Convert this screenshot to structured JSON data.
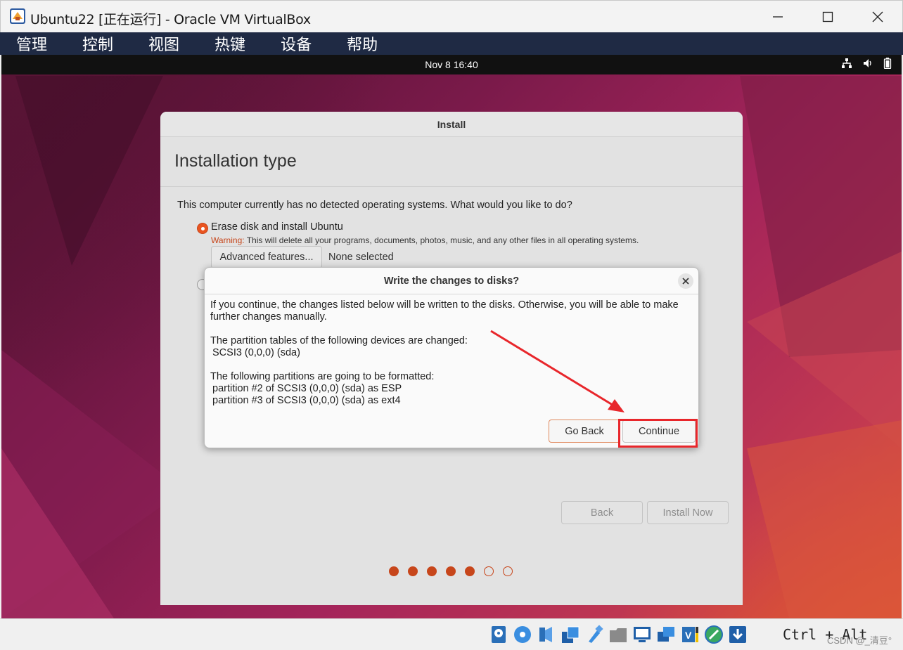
{
  "window": {
    "title": "Ubuntu22 [正在运行] - Oracle VM VirtualBox",
    "app_icon": "virtualbox-icon",
    "controls": [
      "minimize-icon",
      "maximize-icon",
      "close-icon"
    ]
  },
  "menubar": {
    "items": [
      "管理",
      "控制",
      "视图",
      "热键",
      "设备",
      "帮助"
    ]
  },
  "guest_topbar": {
    "clock": "Nov 8  16:40",
    "tray": [
      "network-icon",
      "volume-icon",
      "battery-icon"
    ]
  },
  "installer": {
    "window_title": "Install",
    "page_title": "Installation type",
    "question": "This computer currently has no detected operating systems. What would you like to do?",
    "option_erase": {
      "label": "Erase disk and install Ubuntu",
      "selected": true,
      "warning_word": "Warning:",
      "warning_text": " This will delete all your programs, documents, photos, music, and any other files in all operating systems."
    },
    "option_other": {
      "selected": false
    },
    "advanced_button": "Advanced features...",
    "advanced_status": "None selected",
    "back_button": "Back",
    "install_button": "Install Now",
    "progress": {
      "total_steps": 7,
      "completed_steps": 5
    }
  },
  "dialog": {
    "title": "Write the changes to disks?",
    "intro": "If you continue, the changes listed below will be written to the disks. Otherwise, you will be able to make further changes manually.",
    "tables_heading": "The partition tables of the following devices are changed:",
    "tables_device": "SCSI3 (0,0,0) (sda)",
    "partitions_heading": "The following partitions are going to be formatted:",
    "partition_1": "partition #2 of SCSI3 (0,0,0) (sda) as ESP",
    "partition_2": "partition #3 of SCSI3 (0,0,0) (sda) as ext4",
    "go_back_button": "Go Back",
    "continue_button": "Continue"
  },
  "annotation": {
    "color": "#e8262b"
  },
  "statusbar": {
    "icons": [
      "hard-disk-icon",
      "optical-disc-icon",
      "audio-icon",
      "network-adapters-icon",
      "usb-icon",
      "shared-folders-icon",
      "display-icon",
      "recording-icon",
      "cpu-icon",
      "mouse-integration-icon",
      "download-icon"
    ],
    "host_key": "Ctrl + Alt",
    "watermark": "CSDN @_清豆°"
  },
  "colors": {
    "ubuntu_orange": "#e95420",
    "menubar_bg": "#1f2a44"
  }
}
